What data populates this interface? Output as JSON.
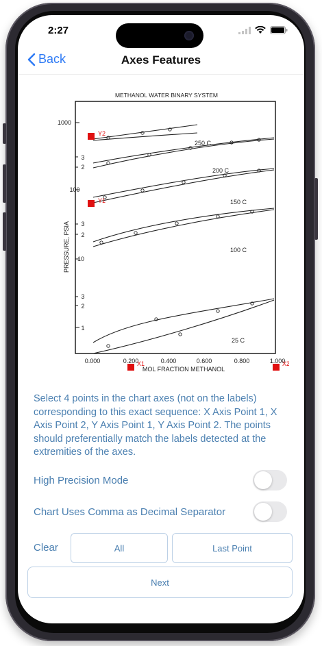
{
  "status_bar": {
    "time": "2:27"
  },
  "nav": {
    "back_label": "Back",
    "title": "Axes Features"
  },
  "chart": {
    "title": "METHANOL WATER BINARY SYSTEM",
    "ylabel": "PRESSURE, PSIA",
    "xlabel": "MOL FRACTION METHANOL",
    "x_ticks": [
      "0.000",
      "0.200",
      "0.400",
      "0.600",
      "0.800",
      "1.000"
    ],
    "y_ticks": [
      "1000",
      "3",
      "2",
      "100",
      "3",
      "2",
      "10",
      "3",
      "2",
      "1"
    ],
    "curve_labels": [
      "250 C",
      "200 C",
      "150 C",
      "100 C",
      "25 C"
    ],
    "markers": [
      "Y2",
      "Y1",
      "X1",
      "X2"
    ]
  },
  "instructions": "Select 4 points in the chart axes (not on the labels) corresponding to this exact sequence: X Axis Point 1, X Axis Point 2, Y Axis Point 1, Y Axis Point 2. The points should preferentially match the labels detected at the extremities of the axes.",
  "settings": {
    "high_precision_label": "High Precision Mode",
    "high_precision_on": false,
    "comma_decimal_label": "Chart Uses Comma as Decimal Separator",
    "comma_decimal_on": false
  },
  "actions": {
    "clear_label": "Clear",
    "all_label": "All",
    "last_point_label": "Last Point",
    "next_label": "Next"
  }
}
